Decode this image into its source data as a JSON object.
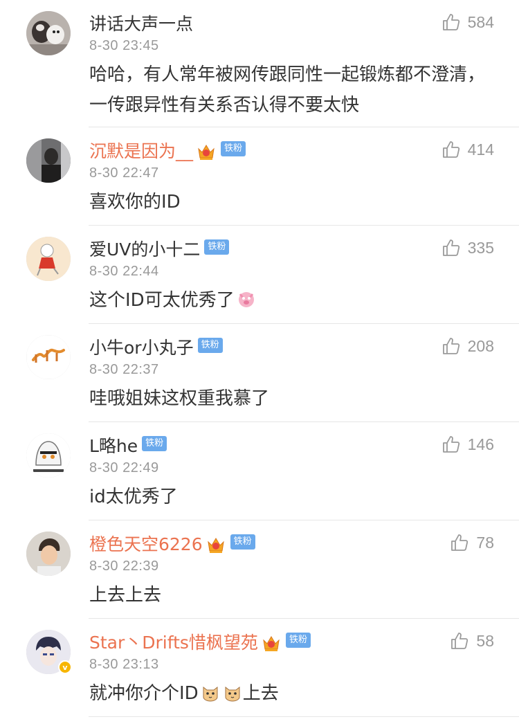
{
  "comments": [
    {
      "name": "讲话大声一点",
      "vip": false,
      "fan_badge": "",
      "time": "8-30 23:45",
      "likes": "584",
      "text": "哈哈，有人常年被网传跟同性一起锻炼都不澄清，一传跟异性有关系否认得不要太快",
      "avatar_icon": "avatar-dogs"
    },
    {
      "name": "沉默是因为__",
      "vip": true,
      "fan_badge": "铁粉",
      "time": "8-30 22:47",
      "likes": "414",
      "text": "喜欢你的ID",
      "avatar_icon": "avatar-person"
    },
    {
      "name": "爱UV的小十二",
      "vip": false,
      "fan_badge": "铁粉",
      "time": "8-30 22:44",
      "likes": "335",
      "text": "这个ID可太优秀了",
      "avatar_icon": "avatar-cartoon-girl",
      "emoji": "pig-emoji"
    },
    {
      "name": "小牛or小丸子",
      "vip": false,
      "fan_badge": "铁粉",
      "time": "8-30 22:37",
      "likes": "208",
      "text": "哇哦姐妹这权重我慕了",
      "avatar_icon": "avatar-text-logo"
    },
    {
      "name": "L略he",
      "vip": false,
      "fan_badge": "铁粉",
      "time": "8-30 22:49",
      "likes": "146",
      "text": "id太优秀了",
      "avatar_icon": "avatar-anime-girl"
    },
    {
      "name": "橙色天空6226",
      "vip": true,
      "fan_badge": "铁粉",
      "time": "8-30 22:39",
      "likes": "78",
      "text": "上去上去",
      "avatar_icon": "avatar-young-man"
    },
    {
      "name": "Star丶Drifts惜枫望苑",
      "vip": true,
      "fan_badge": "铁粉",
      "time": "8-30 23:13",
      "likes": "58",
      "text": "就冲你介个ID",
      "text_suffix": "上去",
      "avatar_icon": "avatar-anime-boy",
      "emoji": "cat-emoji",
      "verified": true
    }
  ],
  "colors": {
    "vip_name": "#eb7350",
    "badge": "#6aa9ec",
    "time": "#999999",
    "divider": "#e6e6e6"
  }
}
